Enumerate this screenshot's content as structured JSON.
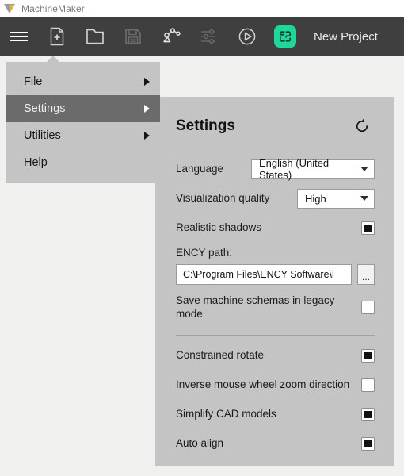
{
  "titlebar": {
    "app_title": "MachineMaker",
    "logo_icon": "triangle-logo-icon"
  },
  "toolbar": {
    "buttons": [
      {
        "name": "menu-button",
        "icon": "hamburger-icon",
        "state": "active"
      },
      {
        "name": "new-file-button",
        "icon": "new-document-icon",
        "state": "normal"
      },
      {
        "name": "open-folder-button",
        "icon": "open-folder-icon",
        "state": "normal"
      },
      {
        "name": "save-button",
        "icon": "floppy-save-icon",
        "state": "disabled"
      },
      {
        "name": "robot-button",
        "icon": "robot-arm-icon",
        "state": "normal"
      },
      {
        "name": "settings-sliders-button",
        "icon": "sliders-icon",
        "state": "disabled"
      },
      {
        "name": "run-button",
        "icon": "play-circle-icon",
        "state": "normal"
      }
    ],
    "brand_badge_icon": "ency-logo-icon",
    "brand_color": "#1fd79b",
    "project_name": "New Project"
  },
  "menu": {
    "items": [
      {
        "label": "File",
        "has_submenu": true,
        "selected": false
      },
      {
        "label": "Settings",
        "has_submenu": true,
        "selected": true
      },
      {
        "label": "Utilities",
        "has_submenu": true,
        "selected": false
      },
      {
        "label": "Help",
        "has_submenu": false,
        "selected": false
      }
    ]
  },
  "panel": {
    "title": "Settings",
    "reset_icon": "reset-rotate-icon",
    "language": {
      "label": "Language",
      "value": "English (United States)"
    },
    "visualization_quality": {
      "label": "Visualization quality",
      "value": "High"
    },
    "realistic_shadows": {
      "label": "Realistic shadows",
      "checked": true
    },
    "ency_path": {
      "label": "ENCY path:",
      "value": "C:\\Program Files\\ENCY Software\\l",
      "browse_label": "..."
    },
    "legacy_mode": {
      "label": "Save machine schemas in legacy mode",
      "checked": false
    },
    "options": [
      {
        "label": "Constrained rotate",
        "checked": true
      },
      {
        "label": "Inverse mouse wheel zoom direction",
        "checked": false
      },
      {
        "label": "Simplify CAD models",
        "checked": true
      },
      {
        "label": "Auto align",
        "checked": true
      }
    ]
  },
  "colors": {
    "toolbar_bg": "#3f3f3f",
    "panel_bg": "#c4c4c4",
    "menu_selected_bg": "#6b6b6b",
    "accent_green": "#1fd79b"
  }
}
